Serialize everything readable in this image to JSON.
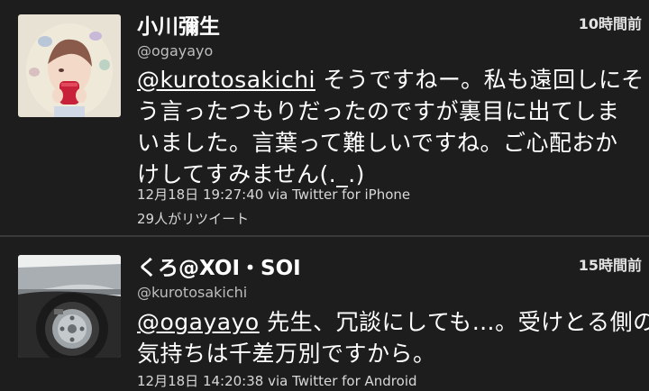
{
  "tweets": [
    {
      "name": "小川彌生",
      "handle": "@ogayayo",
      "time": "10時間前",
      "body_lines": [
        {
          "mention": "@kurotosakichi",
          "text": " そうですねー。私も遠回しにそ"
        },
        {
          "text": "う言ったつもりだったのですが裏目に出てしま"
        },
        {
          "text": "いました。言葉って難しいですね。ご心配おか"
        },
        {
          "text": "けしてすみません(._.)"
        }
      ],
      "meta": "12月18日 19:27:40 via Twitter for iPhone",
      "retweets": "29人がリツイート",
      "avatar_icon": "user-avatar-illustration-icon"
    },
    {
      "name": "くろ@XOI・SOI",
      "handle": "@kurotosakichi",
      "time": "15時間前",
      "body_lines": [
        {
          "mention": "@ogayayo",
          "text": " 先生、冗談にしても…。受けとる側の"
        },
        {
          "text": "気持ちは千差万別ですから。"
        }
      ],
      "meta": "12月18日 14:20:38 via Twitter for Android",
      "avatar_icon": "car-wheel-photo-icon"
    }
  ],
  "colors": {
    "background": "#1d1d1d",
    "divider": "#3a3a3a",
    "text_primary": "#ffffff",
    "text_secondary": "#bdbdbd"
  }
}
